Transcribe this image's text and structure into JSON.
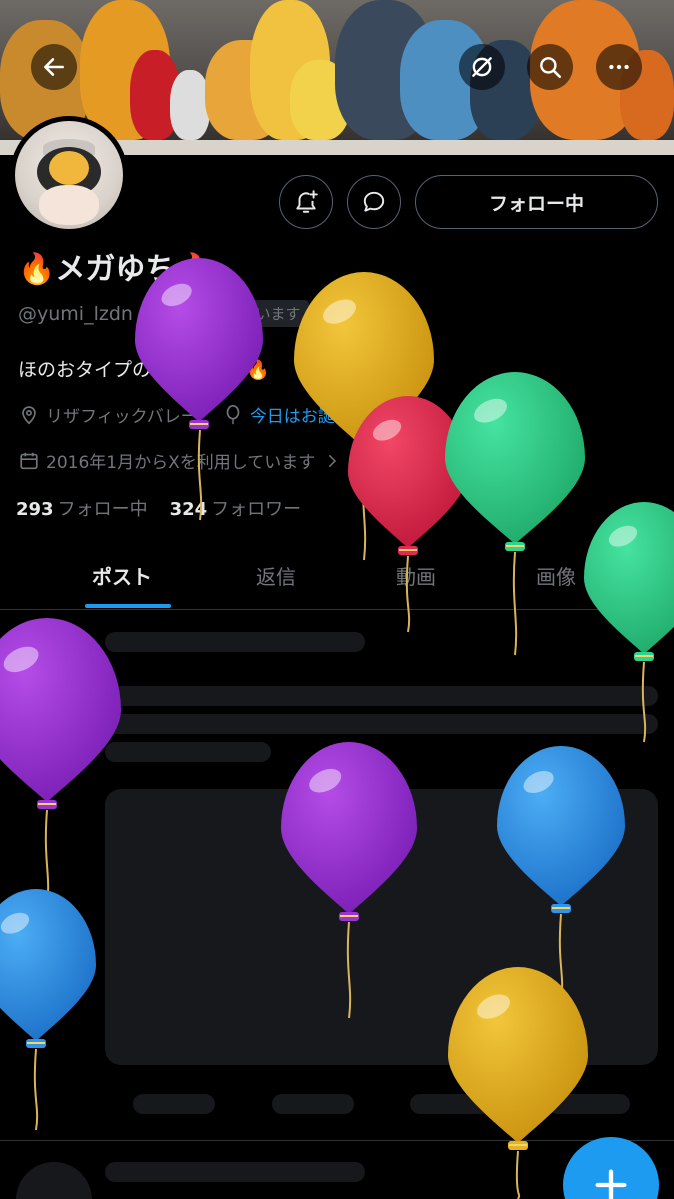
{
  "header": {
    "back_icon": "arrow-left-icon",
    "grok_icon": "grok-slash-icon",
    "search_icon": "search-icon",
    "more_icon": "more-horizontal-icon"
  },
  "profile": {
    "name": "🔥メガゆち🔥",
    "handle": "@yumi_lzdn",
    "follows_you": "フォローされています",
    "bio": "ほのおタイプのトレーナー🔥",
    "location": "リザフィックバレー",
    "birthday": "今日はお誕生日です。",
    "joined": "2016年1月からXを利用しています",
    "following_count": "293",
    "following_label": "フォロー中",
    "followers_count": "324",
    "followers_label": "フォロワー"
  },
  "actions": {
    "follow_label": "フォロー中",
    "notify_icon": "bell-plus-icon",
    "message_icon": "chat-bubble-icon"
  },
  "tabs": [
    {
      "label": "ポスト",
      "active": true
    },
    {
      "label": "返信",
      "active": false
    },
    {
      "label": "動画",
      "active": false
    },
    {
      "label": "画像",
      "active": false
    }
  ],
  "fab": {
    "icon": "plus-icon"
  },
  "colors": {
    "accent": "#1d9bf0",
    "background": "#000000",
    "muted": "#71767b",
    "balloon_purple": "#9b33d1",
    "balloon_yellow": "#e6b31e",
    "balloon_red": "#e2294f",
    "balloon_green": "#2fd48c",
    "balloon_blue": "#2f95e8"
  }
}
